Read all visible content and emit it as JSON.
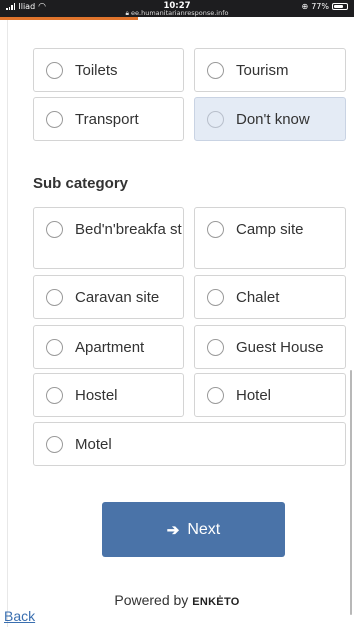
{
  "status_bar": {
    "carrier": "Iliad",
    "time": "10:27",
    "url": "ee.humanitarianresponse.info",
    "battery": "77%",
    "battery_level": 0.77,
    "icons": [
      "signal-icon",
      "wifi-icon",
      "lock-icon",
      "alarm-icon",
      "battery-icon"
    ]
  },
  "page_load_progress": 0.39,
  "category_options": [
    {
      "label": "Toilets",
      "selected": false
    },
    {
      "label": "Tourism",
      "selected": false
    },
    {
      "label": "Transport",
      "selected": false
    },
    {
      "label": "Don't know",
      "selected": true
    }
  ],
  "sub_category": {
    "title": "Sub category",
    "options": [
      {
        "label": "Bed'n'breakfa st"
      },
      {
        "label": "Camp site"
      },
      {
        "label": "Caravan site"
      },
      {
        "label": "Chalet"
      },
      {
        "label": "Apartment"
      },
      {
        "label": "Guest House"
      },
      {
        "label": "Hostel"
      },
      {
        "label": "Hotel"
      },
      {
        "label": "Motel"
      }
    ]
  },
  "next_button": {
    "label": "Next",
    "icon": "arrow-right-icon"
  },
  "footer": {
    "powered_by": "Powered by",
    "brand": "ENKĖTO",
    "back_link": "Back"
  },
  "colors": {
    "accent": "#4a73a8",
    "selected_bg": "#e4ebf5",
    "load_bar": "#e0742c",
    "link": "#3a6fb0"
  }
}
